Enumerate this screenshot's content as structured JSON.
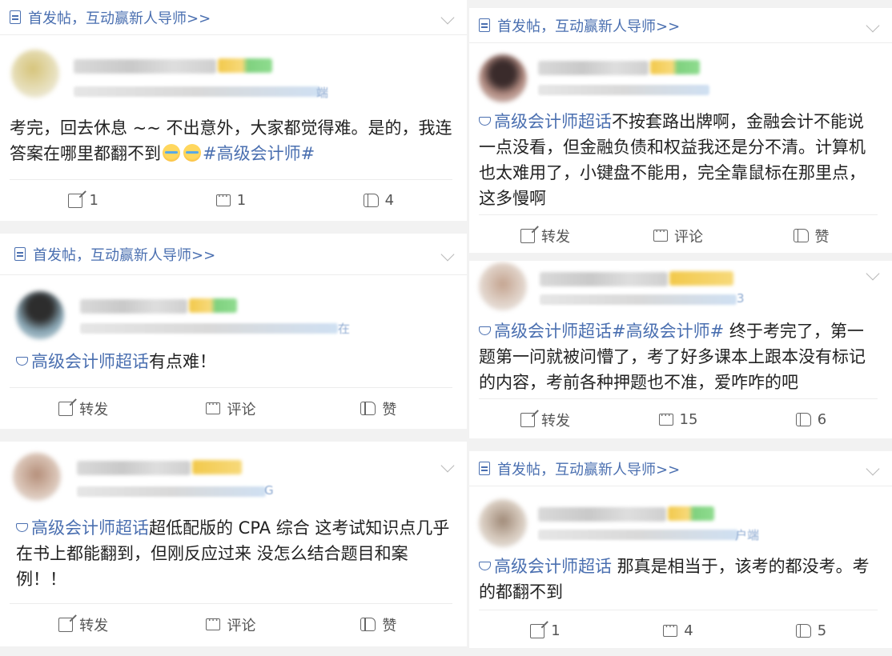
{
  "header_text": "首发帖，互动赢新人导师>>",
  "labels": {
    "repost": "转发",
    "comment": "评论",
    "like": "赞"
  },
  "colors": {
    "accent": "#4a6fb0",
    "text": "#222222",
    "muted": "#555555"
  },
  "posts": [
    {
      "meta_tail": "端",
      "content_text": "考完，回去休息 ~~ 不出意外，大家都觉得难。是的，我连答案在哪里都翻不到",
      "emoji": [
        "crying-laughing-emoji",
        "crying-laughing-emoji"
      ],
      "topic_hashtag": "#高级会计师#",
      "repost": "1",
      "comment": "1",
      "like": "4"
    },
    {
      "meta_tail": "在",
      "super_topic": "高级会计师超话",
      "content_text": "有点难！",
      "repost": "转发",
      "comment": "评论",
      "like": "赞"
    },
    {
      "meta_tail": "G",
      "super_topic": "高级会计师超话",
      "content_text": "超低配版的 CPA 综合 这考试知识点几乎在书上都能翻到，但刚反应过来 没怎么结合题目和案例！！",
      "repost": "转发",
      "comment": "评论",
      "like": "赞"
    },
    {
      "super_topic": "高级会计师超话",
      "content_text": "不按套路出牌啊，金融会计不能说一点没看，但金融负债和权益我还是分不清。计算机也太难用了，小键盘不能用，完全靠鼠标在那里点，这多慢啊",
      "repost": "转发",
      "comment": "评论",
      "like": "赞"
    },
    {
      "meta_tail": "3",
      "super_topic": "高级会计师超话",
      "topic_hashtag": "#高级会计师#",
      "content_text": " 终于考完了，第一题第一问就被问懵了，考了好多课本上跟本没有标记的内容，考前各种押题也不准，爱咋咋的吧",
      "repost": "转发",
      "comment": "15",
      "like": "6"
    },
    {
      "meta_tail": "户端",
      "super_topic": "高级会计师超话",
      "content_text": " 那真是相当于，该考的都没考。考的都翻不到",
      "repost": "1",
      "comment": "4",
      "like": "5"
    }
  ]
}
